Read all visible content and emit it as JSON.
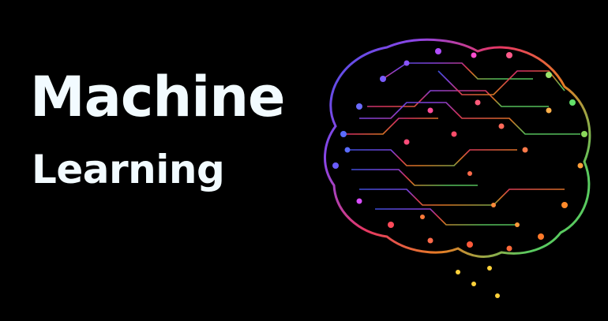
{
  "title": {
    "line1": "Machine",
    "line2": "Learning"
  },
  "colors": {
    "background": "#000000",
    "text": "#f2fbff",
    "gradient": [
      "#4a5cff",
      "#8a4dff",
      "#ff3d6e",
      "#ff8a2a",
      "#ffd23a",
      "#63e06a"
    ]
  },
  "illustration": {
    "icon": "circuit-brain-icon"
  }
}
